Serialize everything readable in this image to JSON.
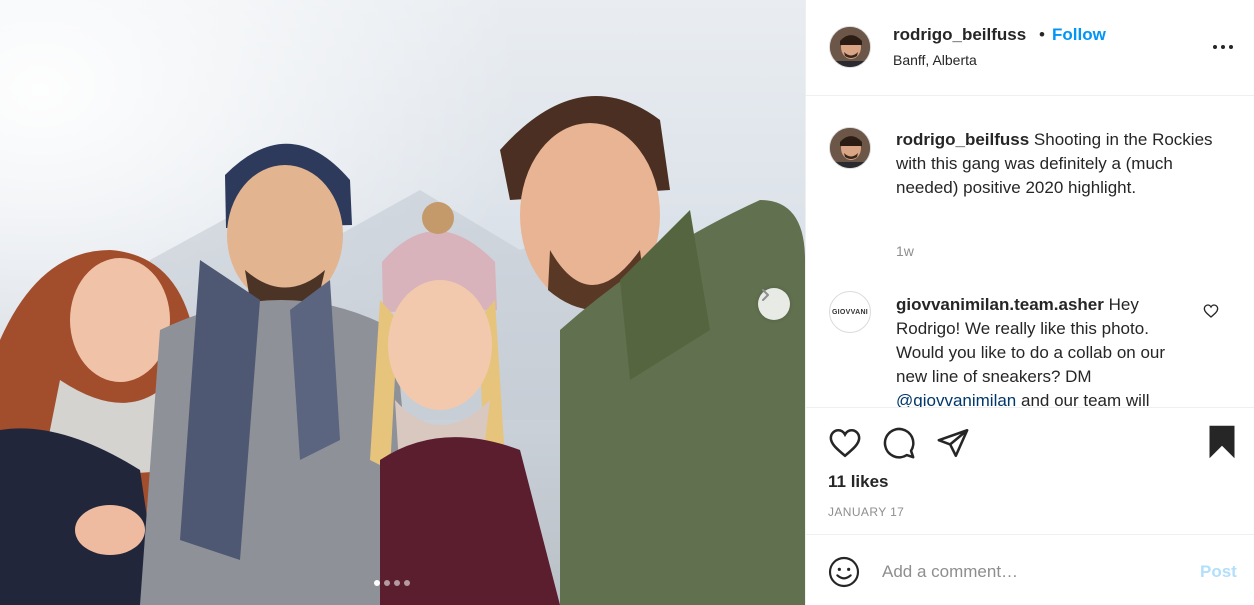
{
  "post": {
    "username": "rodrigo_beilfuss",
    "separator": "•",
    "follow_label": "Follow",
    "location": "Banff, Alberta",
    "more_icon": "more-horizontal-icon"
  },
  "photo": {
    "carousel_count": 4,
    "carousel_active_index": 0
  },
  "caption": {
    "username": "rodrigo_beilfuss",
    "text": "Shooting in the Rockies with this gang was definitely a (much needed) positive 2020 highlight.",
    "time": "1w"
  },
  "comments": [
    {
      "avatar_text": "GIOVVANI",
      "username": "giovvanimilan.team.asher",
      "text_main": "Hey Rodrigo! We really like this photo. Would you like to do a collab on our new line of sneakers? DM",
      "mention": "@giovvanimilan",
      "text_tail": "and our team will"
    }
  ],
  "actions": {
    "like_icon": "heart-icon",
    "comment_icon": "comment-icon",
    "share_icon": "share-icon",
    "save_icon": "bookmark-icon",
    "likes": "11 likes",
    "date": "JANUARY 17"
  },
  "add_comment": {
    "placeholder": "Add a comment…",
    "post_label": "Post",
    "emoji_icon": "emoji-icon"
  },
  "colors": {
    "follow": "#0095f6",
    "post_disabled": "#b2dffc",
    "secondary_text": "#8e8e8e",
    "border": "#efefef"
  }
}
